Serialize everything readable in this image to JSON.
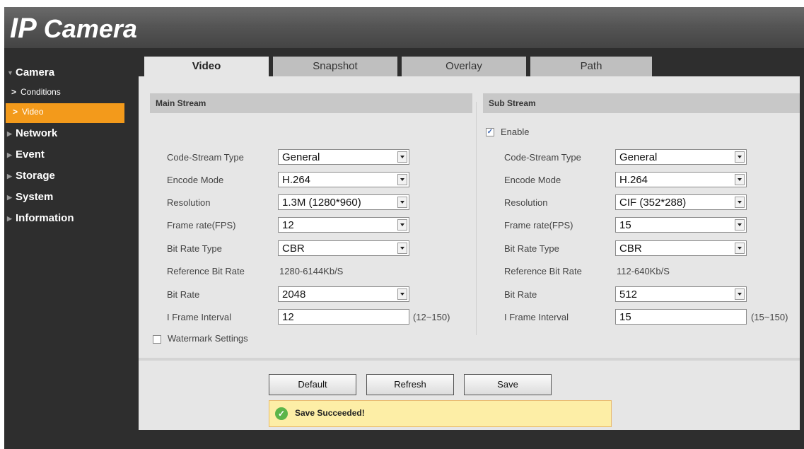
{
  "app": {
    "logo_ip": "IP",
    "logo_word": " Camera"
  },
  "sidebar": {
    "items": [
      {
        "label": "Camera",
        "expanded": true
      },
      {
        "label": "Network"
      },
      {
        "label": "Event"
      },
      {
        "label": "Storage"
      },
      {
        "label": "System"
      },
      {
        "label": "Information"
      }
    ],
    "subitems": [
      {
        "label": "Conditions",
        "active": false
      },
      {
        "label": "Video",
        "active": true
      }
    ]
  },
  "tabs": [
    {
      "label": "Video",
      "active": true
    },
    {
      "label": "Snapshot"
    },
    {
      "label": "Overlay"
    },
    {
      "label": "Path"
    }
  ],
  "main_stream": {
    "title": "Main Stream",
    "labels": {
      "code_stream_type": "Code-Stream Type",
      "encode_mode": "Encode Mode",
      "resolution": "Resolution",
      "frame_rate": "Frame rate(FPS)",
      "bit_rate_type": "Bit Rate Type",
      "reference_bit_rate": "Reference Bit Rate",
      "bit_rate": "Bit Rate",
      "i_frame_interval": "I Frame Interval"
    },
    "values": {
      "code_stream_type": "General",
      "encode_mode": "H.264",
      "resolution": "1.3M (1280*960)",
      "frame_rate": "12",
      "bit_rate_type": "CBR",
      "reference_bit_rate": "1280-6144Kb/S",
      "bit_rate": "2048",
      "i_frame_interval": "12",
      "i_frame_range": "(12~150)"
    },
    "watermark_label": "Watermark Settings",
    "watermark_checked": false
  },
  "sub_stream": {
    "title": "Sub Stream",
    "enable_label": "Enable",
    "enable_checked": true,
    "labels": {
      "code_stream_type": "Code-Stream Type",
      "encode_mode": "Encode Mode",
      "resolution": "Resolution",
      "frame_rate": "Frame rate(FPS)",
      "bit_rate_type": "Bit Rate Type",
      "reference_bit_rate": "Reference Bit Rate",
      "bit_rate": "Bit Rate",
      "i_frame_interval": "I Frame Interval"
    },
    "values": {
      "code_stream_type": "General",
      "encode_mode": "H.264",
      "resolution": "CIF (352*288)",
      "frame_rate": "15",
      "bit_rate_type": "CBR",
      "reference_bit_rate": "112-640Kb/S",
      "bit_rate": "512",
      "i_frame_interval": "15",
      "i_frame_range": "(15~150)"
    }
  },
  "buttons": {
    "default": "Default",
    "refresh": "Refresh",
    "save": "Save"
  },
  "message": {
    "text": "Save Succeeded!",
    "icon": "check-icon"
  },
  "colors": {
    "accent": "#f39a1b",
    "background": "#2e2e2e",
    "panel": "#e6e6e6",
    "message_bg": "#fdeea6"
  }
}
